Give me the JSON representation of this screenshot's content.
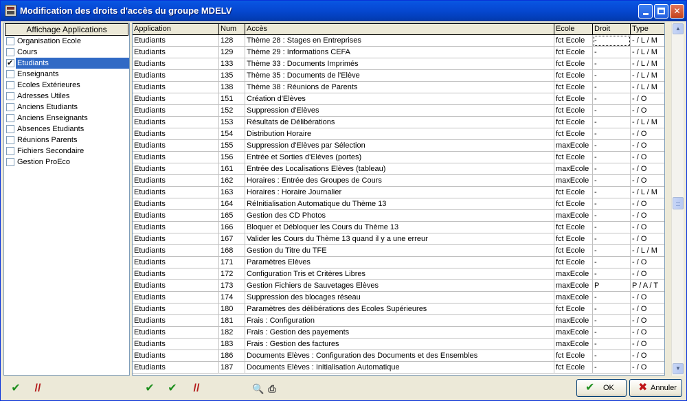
{
  "window": {
    "title": "Modification des droits d'accès du groupe MDELV"
  },
  "apps": {
    "header": "Affichage Applications",
    "items": [
      {
        "label": "Organisation Ecole",
        "checked": false,
        "selected": false
      },
      {
        "label": "Cours",
        "checked": false,
        "selected": false
      },
      {
        "label": "Etudiants",
        "checked": true,
        "selected": true
      },
      {
        "label": "Enseignants",
        "checked": false,
        "selected": false
      },
      {
        "label": "Ecoles Extérieures",
        "checked": false,
        "selected": false
      },
      {
        "label": "Adresses Utiles",
        "checked": false,
        "selected": false
      },
      {
        "label": "Anciens Etudiants",
        "checked": false,
        "selected": false
      },
      {
        "label": "Anciens Enseignants",
        "checked": false,
        "selected": false
      },
      {
        "label": "Absences Etudiants",
        "checked": false,
        "selected": false
      },
      {
        "label": "Réunions Parents",
        "checked": false,
        "selected": false
      },
      {
        "label": "Fichiers Secondaire",
        "checked": false,
        "selected": false
      },
      {
        "label": "Gestion ProEco",
        "checked": false,
        "selected": false
      }
    ]
  },
  "grid": {
    "columns": {
      "application": "Application",
      "num": "Num",
      "acces": "Accès",
      "ecole": "Ecole",
      "droit": "Droit",
      "type": "Type"
    },
    "rows": [
      {
        "app": "Etudiants",
        "num": "128",
        "acces": "Thème 28 : Stages en Entreprises",
        "ecole": "fct Ecole",
        "droit": "-",
        "type": "- / L / M"
      },
      {
        "app": "Etudiants",
        "num": "129",
        "acces": "Thème 29 : Informations CEFA",
        "ecole": "fct Ecole",
        "droit": "-",
        "type": "- / L / M"
      },
      {
        "app": "Etudiants",
        "num": "133",
        "acces": "Thème 33 : Documents Imprimés",
        "ecole": "fct Ecole",
        "droit": "-",
        "type": "- / L / M"
      },
      {
        "app": "Etudiants",
        "num": "135",
        "acces": "Thème 35 : Documents de l'Elève",
        "ecole": "fct Ecole",
        "droit": "-",
        "type": "- / L / M"
      },
      {
        "app": "Etudiants",
        "num": "138",
        "acces": "Thème 38 : Réunions de Parents",
        "ecole": "fct Ecole",
        "droit": "-",
        "type": "- / L / M"
      },
      {
        "app": "Etudiants",
        "num": "151",
        "acces": "Création d'Elèves",
        "ecole": "fct Ecole",
        "droit": "-",
        "type": "- / O"
      },
      {
        "app": "Etudiants",
        "num": "152",
        "acces": "Suppression d'Elèves",
        "ecole": "fct Ecole",
        "droit": "-",
        "type": "- / O"
      },
      {
        "app": "Etudiants",
        "num": "153",
        "acces": "Résultats de Délibérations",
        "ecole": "fct Ecole",
        "droit": "-",
        "type": "- / L / M"
      },
      {
        "app": "Etudiants",
        "num": "154",
        "acces": "Distribution Horaire",
        "ecole": "fct Ecole",
        "droit": "-",
        "type": "- / O"
      },
      {
        "app": "Etudiants",
        "num": "155",
        "acces": "Suppression d'Elèves par Sélection",
        "ecole": "maxEcole",
        "droit": "-",
        "type": "- / O"
      },
      {
        "app": "Etudiants",
        "num": "156",
        "acces": "Entrée et Sorties d'Elèves (portes)",
        "ecole": "fct Ecole",
        "droit": "-",
        "type": "- / O"
      },
      {
        "app": "Etudiants",
        "num": "161",
        "acces": "Entrée des Localisations Elèves (tableau)",
        "ecole": "maxEcole",
        "droit": "-",
        "type": "- / O"
      },
      {
        "app": "Etudiants",
        "num": "162",
        "acces": "Horaires : Entrée des Groupes de Cours",
        "ecole": "maxEcole",
        "droit": "-",
        "type": "- / O"
      },
      {
        "app": "Etudiants",
        "num": "163",
        "acces": "Horaires : Horaire Journalier",
        "ecole": "fct Ecole",
        "droit": "-",
        "type": "- / L / M"
      },
      {
        "app": "Etudiants",
        "num": "164",
        "acces": "RéInitialisation Automatique du Thème 13",
        "ecole": "fct Ecole",
        "droit": "-",
        "type": "- / O"
      },
      {
        "app": "Etudiants",
        "num": "165",
        "acces": "Gestion des CD Photos",
        "ecole": "maxEcole",
        "droit": "-",
        "type": "- / O"
      },
      {
        "app": "Etudiants",
        "num": "166",
        "acces": "Bloquer et Débloquer les Cours du Thème 13",
        "ecole": "fct Ecole",
        "droit": "-",
        "type": "- / O"
      },
      {
        "app": "Etudiants",
        "num": "167",
        "acces": "Valider les Cours du Thème 13 quand il y a une erreur",
        "ecole": "fct Ecole",
        "droit": "-",
        "type": "- / O"
      },
      {
        "app": "Etudiants",
        "num": "168",
        "acces": "Gestion du Titre du TFE",
        "ecole": "fct Ecole",
        "droit": "-",
        "type": "- / L / M"
      },
      {
        "app": "Etudiants",
        "num": "171",
        "acces": "Paramètres Elèves",
        "ecole": "fct Ecole",
        "droit": "-",
        "type": "- / O"
      },
      {
        "app": "Etudiants",
        "num": "172",
        "acces": "Configuration Tris et Critères Libres",
        "ecole": "maxEcole",
        "droit": "-",
        "type": "- / O"
      },
      {
        "app": "Etudiants",
        "num": "173",
        "acces": "Gestion Fichiers de Sauvetages Elèves",
        "ecole": "maxEcole",
        "droit": "P",
        "type": "P / A / T"
      },
      {
        "app": "Etudiants",
        "num": "174",
        "acces": "Suppression des blocages réseau",
        "ecole": "maxEcole",
        "droit": "-",
        "type": "- / O"
      },
      {
        "app": "Etudiants",
        "num": "180",
        "acces": "Paramètres des délibérations des Ecoles Supérieures",
        "ecole": "fct Ecole",
        "droit": "-",
        "type": "- / O"
      },
      {
        "app": "Etudiants",
        "num": "181",
        "acces": "Frais : Configuration",
        "ecole": "maxEcole",
        "droit": "-",
        "type": "- / O"
      },
      {
        "app": "Etudiants",
        "num": "182",
        "acces": "Frais : Gestion des payements",
        "ecole": "maxEcole",
        "droit": "-",
        "type": "- / O"
      },
      {
        "app": "Etudiants",
        "num": "183",
        "acces": "Frais : Gestion des factures",
        "ecole": "maxEcole",
        "droit": "-",
        "type": "- / O"
      },
      {
        "app": "Etudiants",
        "num": "186",
        "acces": "Documents Elèves : Configuration des Documents et des Ensembles",
        "ecole": "fct Ecole",
        "droit": "-",
        "type": "- / O"
      },
      {
        "app": "Etudiants",
        "num": "187",
        "acces": "Documents Elèves : Initialisation Automatique",
        "ecole": "fct Ecole",
        "droit": "-",
        "type": "- / O"
      }
    ]
  },
  "buttons": {
    "ok": "OK",
    "cancel": "Annuler"
  }
}
